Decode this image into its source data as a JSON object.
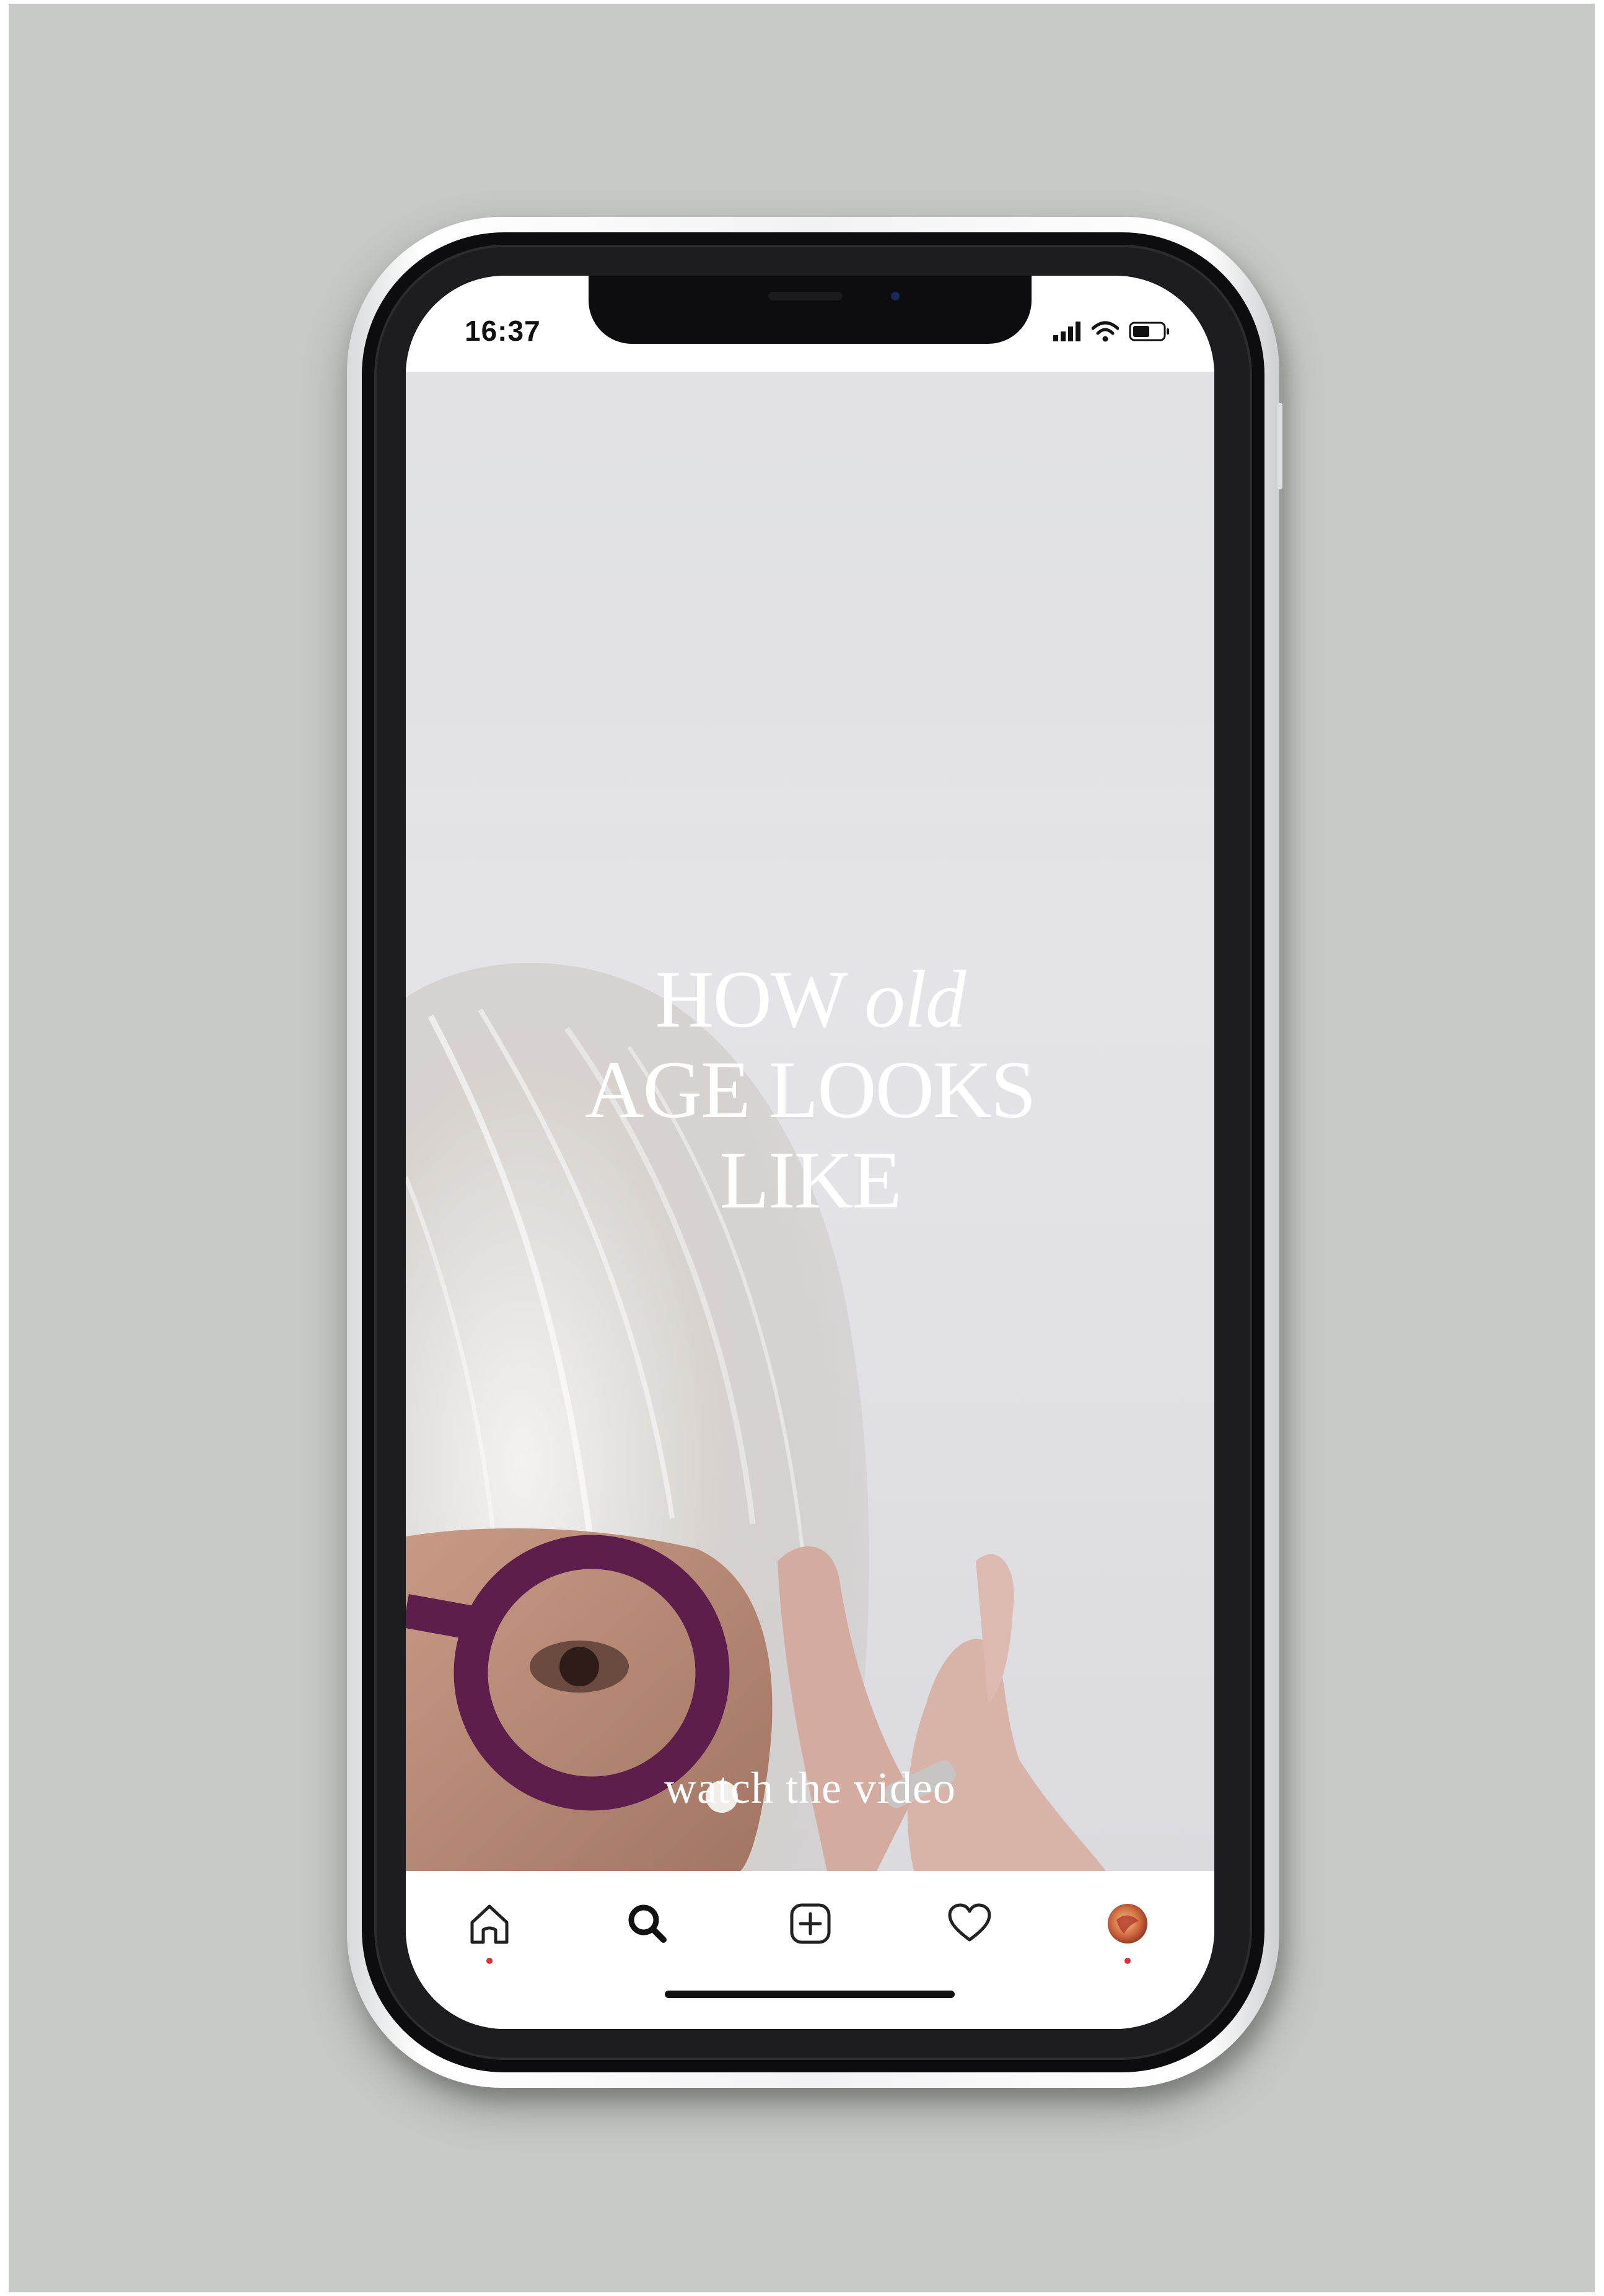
{
  "status_bar": {
    "time": "16:37"
  },
  "story": {
    "headline_line1_word": "HOW",
    "headline_line1_italic": "old",
    "headline_line2": "AGE LOOKS",
    "headline_line3": "LIKE",
    "cta": "watch the video"
  },
  "tab_bar": {
    "tabs": [
      {
        "icon": "home-icon",
        "active": true
      },
      {
        "icon": "search-icon",
        "active": false
      },
      {
        "icon": "add-post-icon",
        "active": false
      },
      {
        "icon": "heart-icon",
        "active": false
      },
      {
        "icon": "profile-avatar",
        "active": false
      }
    ]
  },
  "colors": {
    "backdrop": "#c7c9c6",
    "notification_dot": "#e0303a",
    "glasses": "#5d1e4c"
  }
}
